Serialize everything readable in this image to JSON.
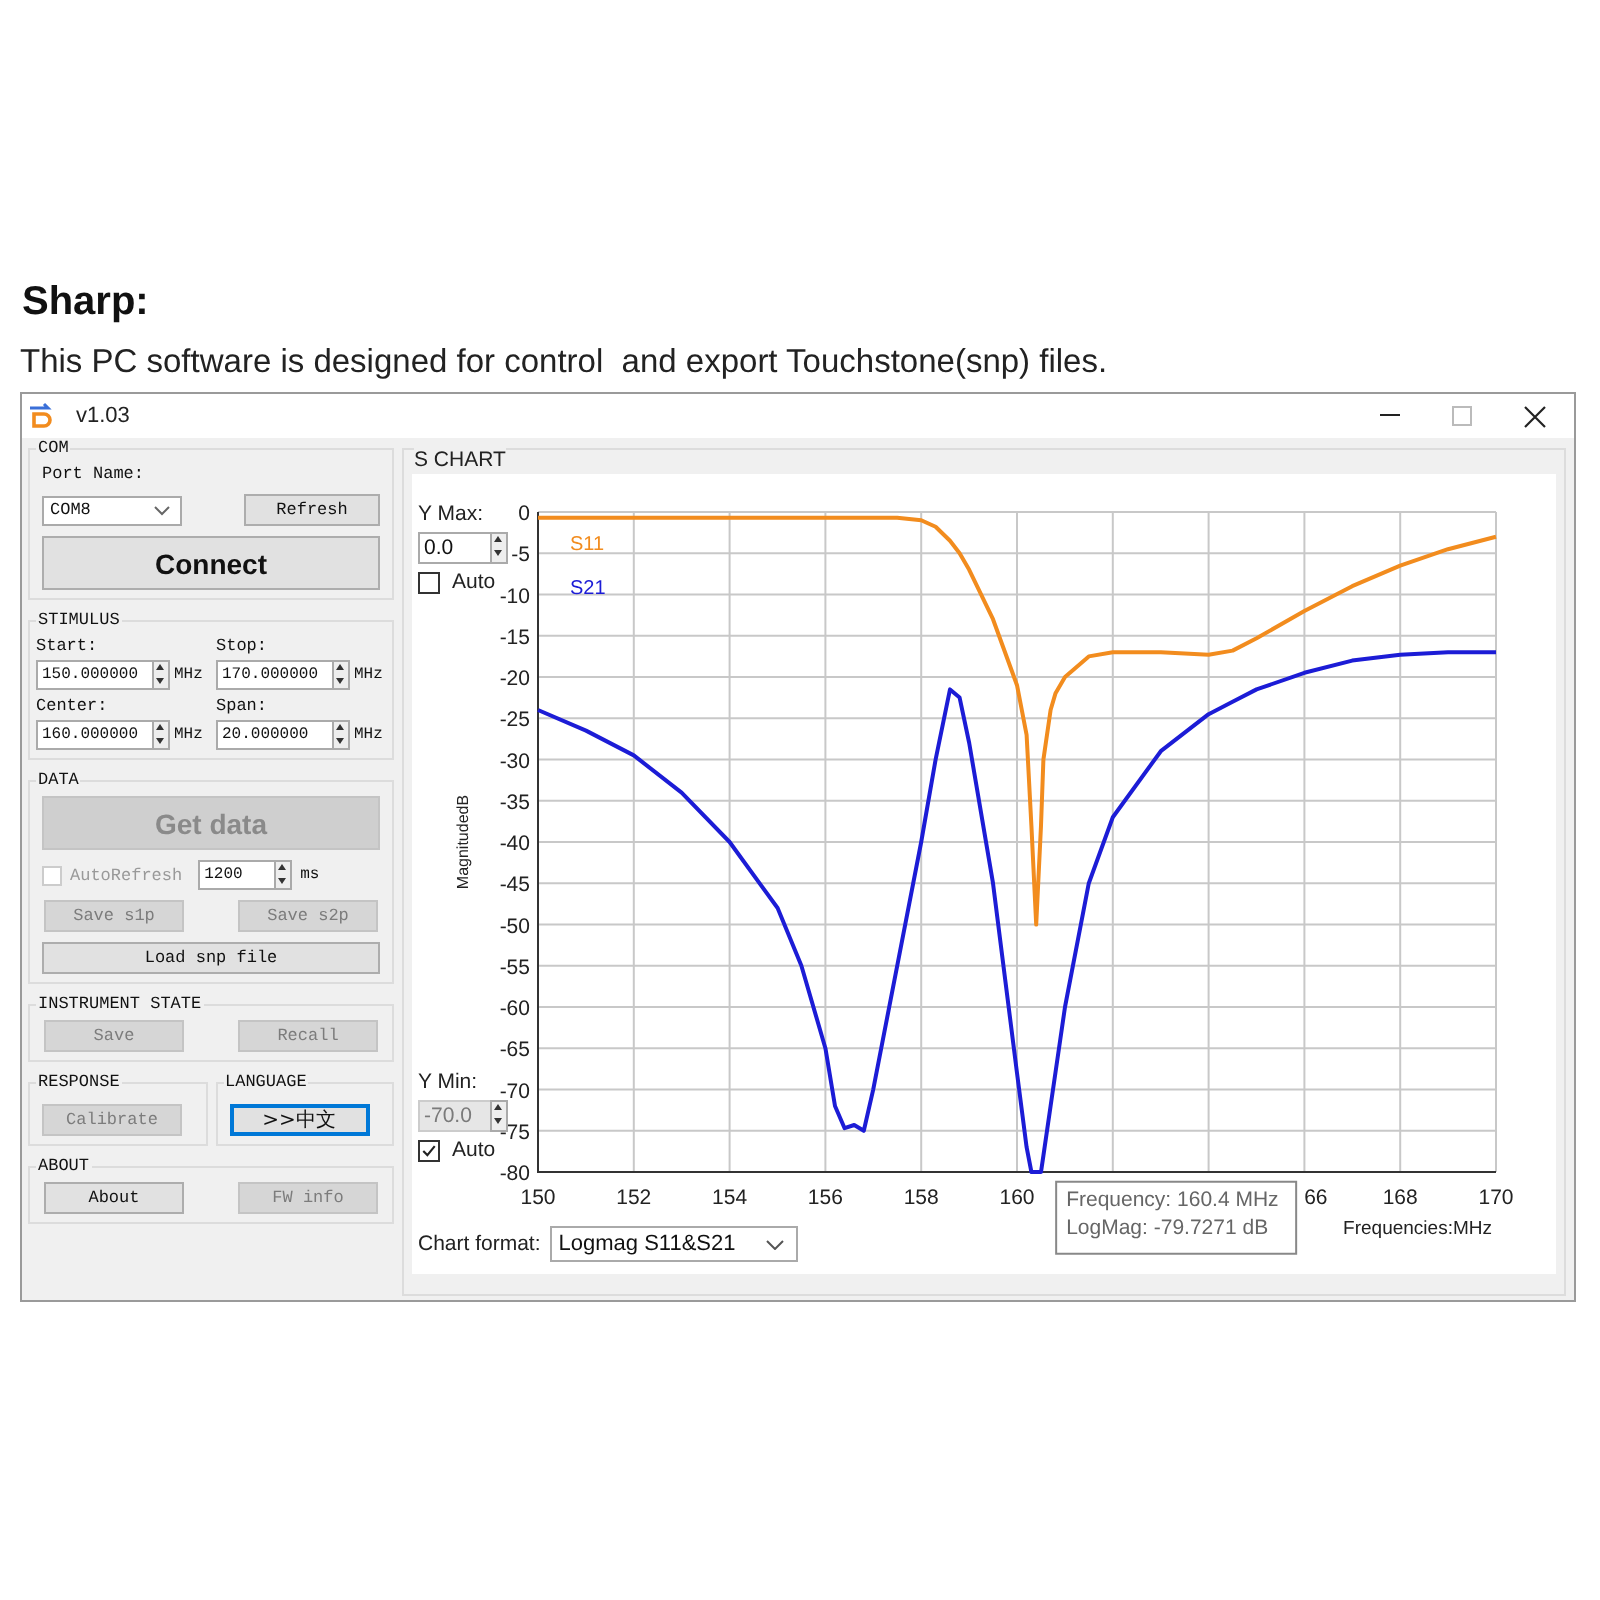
{
  "heading": "Sharp:",
  "description": "This PC software is designed for control  and export Touchstone(snp) files.",
  "window": {
    "title": "v1.03"
  },
  "com": {
    "title": "COM",
    "port_label": "Port Name:",
    "port": "COM8",
    "refresh": {
      "label": "Refresh",
      "disabled": false
    },
    "connect": {
      "label": "Connect",
      "disabled": false
    }
  },
  "stimulus": {
    "title": "STIMULUS",
    "fields": [
      {
        "label": "Start:",
        "value": "150.000000",
        "unit": "MHz"
      },
      {
        "label": "Stop:",
        "value": "170.000000",
        "unit": "MHz"
      },
      {
        "label": "Center:",
        "value": "160.000000",
        "unit": "MHz"
      },
      {
        "label": "Span:",
        "value": "20.000000",
        "unit": "MHz"
      }
    ]
  },
  "data": {
    "title": "DATA",
    "get_data": {
      "label": "Get data",
      "disabled": true
    },
    "auto_refresh": {
      "label": "AutoRefresh",
      "checked": false,
      "disabled": true
    },
    "interval": "1200",
    "interval_unit": "ms",
    "save_buttons": [
      {
        "label": "Save s1p",
        "disabled": true
      },
      {
        "label": "Save s2p",
        "disabled": true
      }
    ],
    "load": {
      "label": "Load snp file",
      "disabled": false
    }
  },
  "instrument_state": {
    "title": "INSTRUMENT STATE",
    "buttons": [
      {
        "label": "Save",
        "disabled": true
      },
      {
        "label": "Recall",
        "disabled": true
      }
    ]
  },
  "response": {
    "title": "RESPONSE",
    "button": {
      "label": "Calibrate",
      "disabled": true
    }
  },
  "language": {
    "title": "LANGUAGE",
    "button": {
      "label": ">>中文",
      "disabled": false,
      "focused": true
    }
  },
  "about": {
    "title": "ABOUT",
    "buttons": [
      {
        "label": "About",
        "disabled": false
      },
      {
        "label": "FW info",
        "disabled": true
      }
    ]
  },
  "s_chart": {
    "title": "S CHART",
    "y_max": {
      "label": "Y Max:",
      "value": "0.0",
      "auto_label": "Auto",
      "auto": false
    },
    "y_min": {
      "label": "Y Min:",
      "value": "-70.0",
      "auto_label": "Auto",
      "auto": true
    },
    "chart_data": {
      "type": "line",
      "xlabel": "Frequencies:MHz",
      "ylabel": "MagnitudedB",
      "grid": true,
      "x": [
        150,
        151,
        152,
        153,
        154,
        155,
        155.5,
        156,
        156.2,
        156.4,
        156.6,
        156.8,
        157,
        157.5,
        158,
        158.3,
        158.6,
        158.8,
        159,
        159.5,
        160,
        160.2,
        160.3,
        160.4,
        160.5,
        160.55,
        160.7,
        160.8,
        161,
        161.5,
        162,
        163,
        164,
        164.5,
        165,
        166,
        167,
        168,
        169,
        170
      ],
      "series": [
        {
          "name": "S11",
          "color": "#f28c1e",
          "values": [
            -0.7,
            -0.7,
            -0.7,
            -0.7,
            -0.7,
            -0.7,
            -0.7,
            -0.7,
            -0.7,
            -0.7,
            -0.7,
            -0.7,
            -0.7,
            -0.7,
            -1.0,
            -1.8,
            -3.5,
            -5,
            -7,
            -13,
            -21,
            -27,
            -38,
            -50,
            -38,
            -30,
            -24,
            -22,
            -20,
            -17.5,
            -17,
            -17,
            -17.3,
            -16.8,
            -15.3,
            -12,
            -9,
            -6.5,
            -4.5,
            -3
          ]
        },
        {
          "name": "S21",
          "color": "#1c1cd6",
          "values": [
            -24,
            -26.5,
            -29.5,
            -34,
            -40,
            -48,
            -55,
            -65,
            -72,
            -74.7,
            -74.3,
            -75,
            -70,
            -55,
            -40,
            -30,
            -21.5,
            -22.5,
            -28,
            -45,
            -68,
            -77,
            -80,
            -80,
            -80,
            -78,
            -72,
            -68,
            -60,
            -45,
            -37,
            -29,
            -24.5,
            -23,
            -21.5,
            -19.5,
            -18,
            -17.3,
            -17,
            -17
          ]
        }
      ],
      "xlim": [
        150,
        170
      ],
      "ylim": [
        -80,
        0
      ],
      "xticks": [
        150,
        152,
        154,
        156,
        158,
        160,
        168,
        170
      ],
      "yticks": [
        0,
        -5,
        -10,
        -15,
        -20,
        -25,
        -30,
        -35,
        -40,
        -45,
        -50,
        -55,
        -60,
        -65,
        -70,
        -75,
        -80
      ],
      "annotations": [
        {
          "text": "Frequency:  160.4 MHz"
        },
        {
          "text": "LogMag:  -79.7271 dB"
        }
      ]
    },
    "partial_tick_label": "66",
    "format_label": "Chart format:",
    "format": "Logmag S11&S21"
  }
}
